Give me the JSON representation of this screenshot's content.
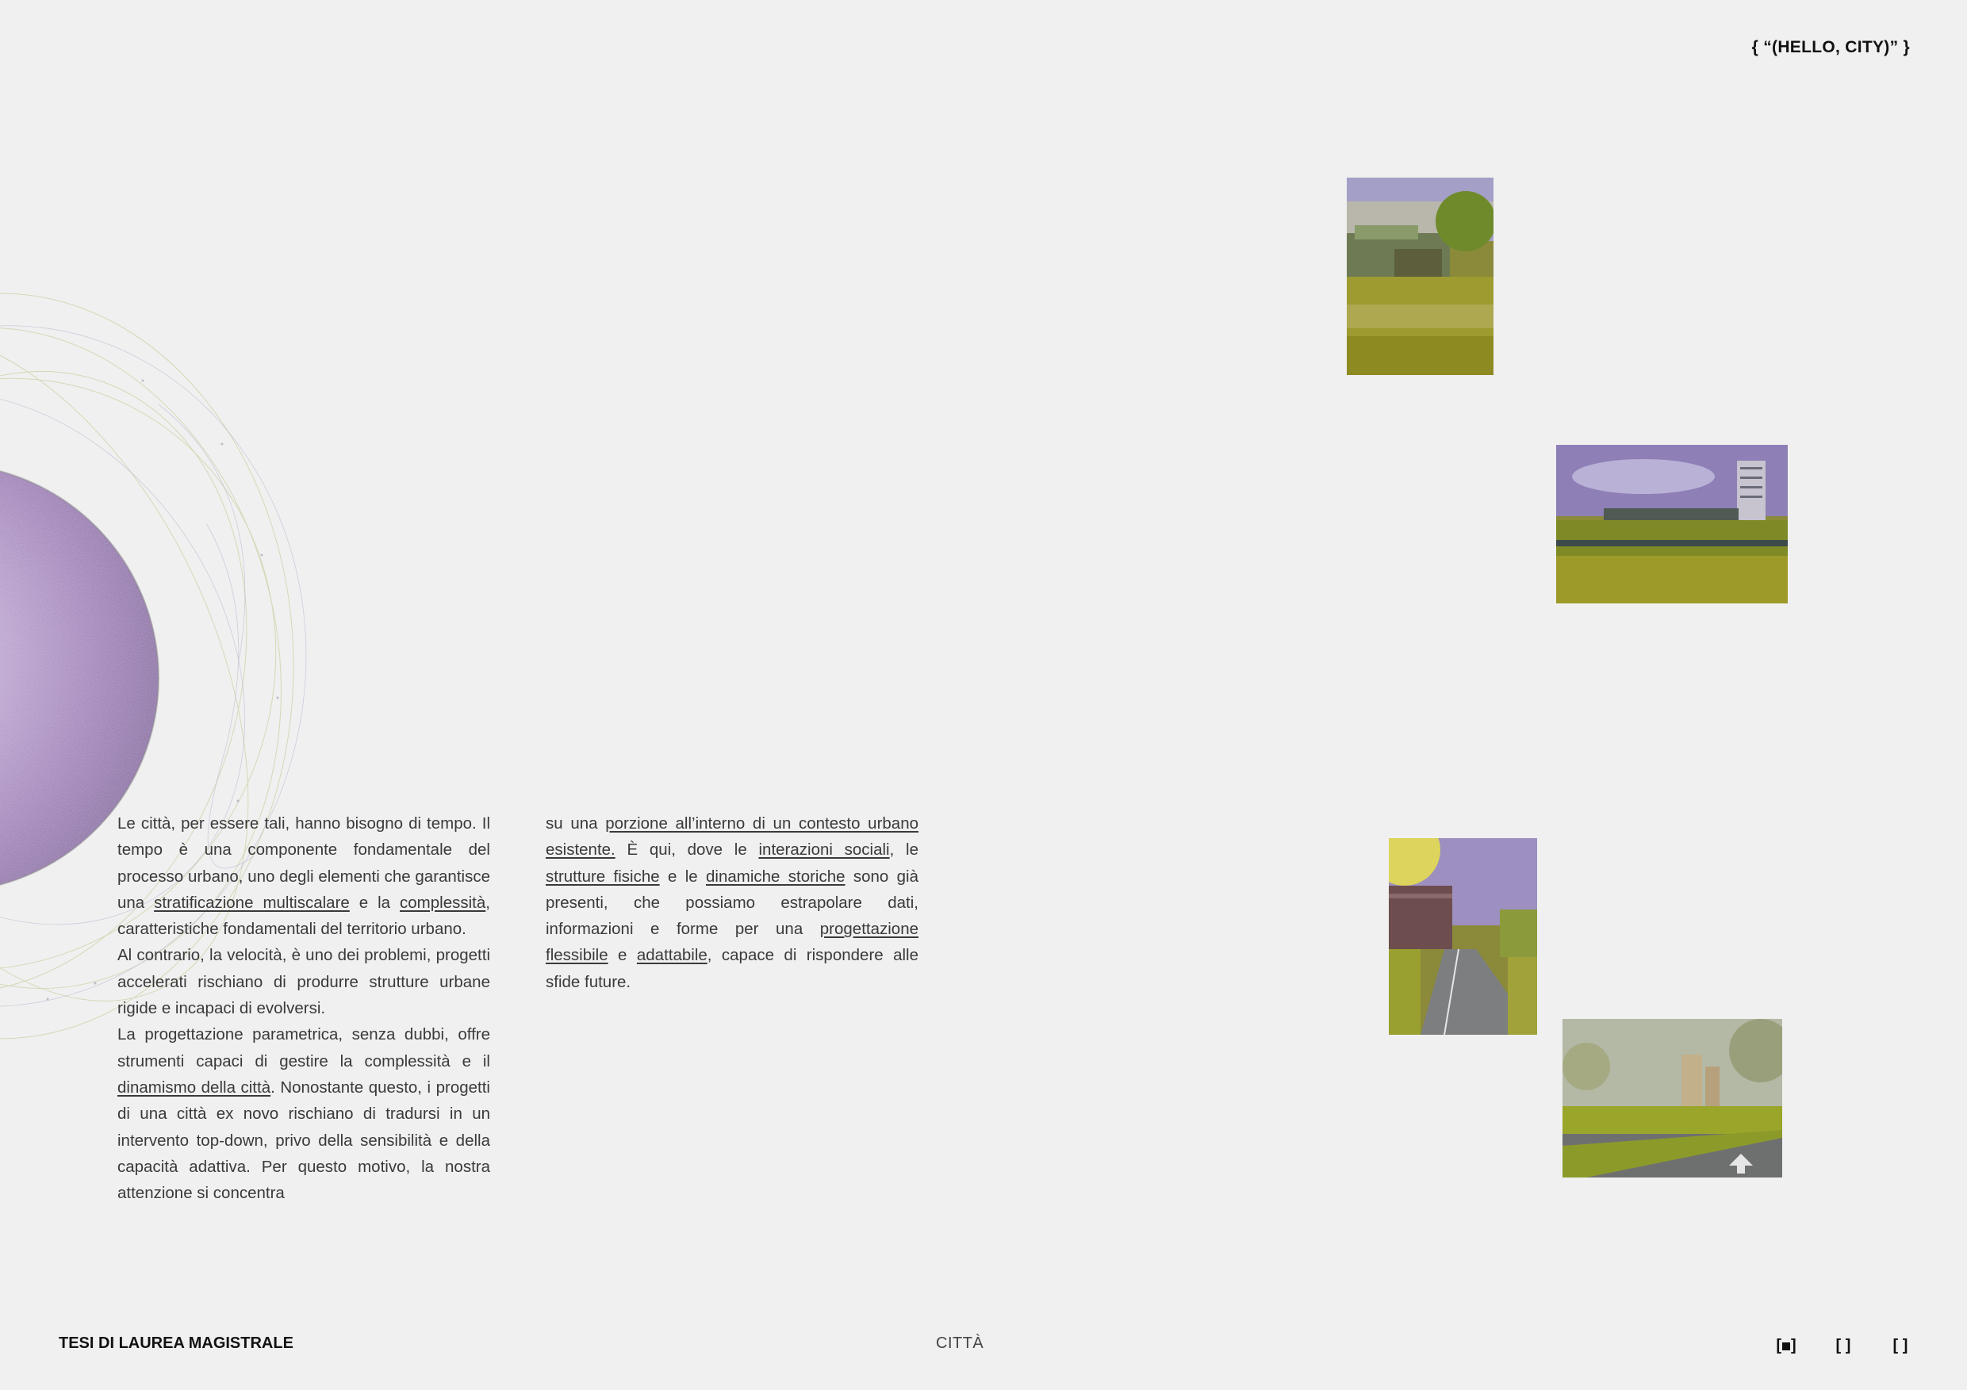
{
  "header": {
    "tag": "{  “(HELLO, CITY)”  }"
  },
  "column_1": [
    [
      {
        "t": "Le città, per essere tali, hanno bisogno di tempo. Il tempo è una componente fondamentale del processo urbano, uno degli elementi che garantisce una "
      },
      {
        "t": "stratificazione multiscalare",
        "u": true
      },
      {
        "t": " e la "
      },
      {
        "t": "complessità",
        "u": true
      },
      {
        "t": ", caratteristiche fondamentali del territorio urbano."
      }
    ],
    [
      {
        "t": "Al contrario, la velocità, è uno dei problemi, progetti accelerati rischiano di produrre strutture urbane rigide e incapaci di evolversi."
      }
    ],
    [
      {
        "t": "La progettazione parametrica, senza dubbi, offre strumenti capaci di gestire la complessità e il "
      },
      {
        "t": "dinamismo della città",
        "u": true
      },
      {
        "t": ". Nonostante questo, i progetti di una città ex novo rischiano di tradursi in un intervento top-down, privo della sensibilità e della capacità adattiva. Per questo motivo, la nostra attenzione si concentra"
      }
    ]
  ],
  "column_2": [
    [
      {
        "t": "su una "
      },
      {
        "t": "porzione all’interno di un contesto urbano esistente.",
        "u": true
      },
      {
        "t": " È qui, dove le "
      },
      {
        "t": "interazioni sociali",
        "u": true
      },
      {
        "t": ", le "
      },
      {
        "t": "strutture fisiche",
        "u": true
      },
      {
        "t": " e le "
      },
      {
        "t": "dinamiche storiche",
        "u": true
      },
      {
        "t": " sono già presenti, che possiamo estrapolare dati, informazioni e forme per una "
      },
      {
        "t": "progettazione flessibile",
        "u": true
      },
      {
        "t": " e "
      },
      {
        "t": "adattabile",
        "u": true
      },
      {
        "t": ", capace di rispondere alle sfide future."
      }
    ]
  ],
  "footer": {
    "left": "TESI DI LAUREA MAGISTRALE",
    "center": "CITTÀ"
  },
  "page_indicators": {
    "total": 3,
    "active": 1
  },
  "colors": {
    "background": "#f0f0f0",
    "planet": "#9a7fb3",
    "photo_grass": "#a8a83a",
    "photo_sky": "#9c8fc4"
  }
}
